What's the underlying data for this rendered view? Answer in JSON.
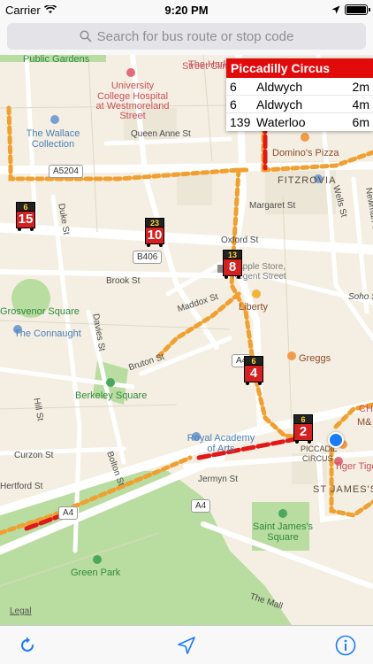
{
  "status": {
    "carrier": "Carrier",
    "time": "9:20 PM"
  },
  "search": {
    "placeholder": "Search for bus route or stop code"
  },
  "map": {
    "labels": {
      "public_gardens": "Public Gardens",
      "harley_street": "The Harley",
      "street_clinic": "Street Clini",
      "uch1": "University",
      "uch2": "College Hospital",
      "uch3": "at Westmoreland",
      "uch4": "Street",
      "queen_anne": "Queen Anne St",
      "wallace1": "The Wallace",
      "wallace2": "Collection",
      "dominos": "Domino's Pizza",
      "fitzrovia": "FITZROVIA",
      "margaret": "Margaret St",
      "wells": "Wells St",
      "newman": "Newman St",
      "duke": "Duke St",
      "oxford": "Oxford St",
      "apple1": "Apple Store,",
      "apple2": "Regent Street",
      "brook": "Brook St",
      "maddox": "Maddox St",
      "liberty": "Liberty",
      "soho": "Soho S",
      "grosvenor": "Grosvenor Square",
      "connaught": "The Connaught",
      "davies": "Davies St",
      "bruton": "Bruton St",
      "greggs": "Greggs",
      "berkeley": "Berkeley Square",
      "hill": "Hill St",
      "royal1": "Royal Academy",
      "royal2": "of Arts",
      "piccadilly1": "PICCADIL",
      "piccadilly2": "CIRCUS",
      "tiger": "Tiger Tige",
      "stjames": "ST JAMES'S",
      "curzon": "Curzon St",
      "bolton": "Bolton St",
      "jermyn": "Jermyn St",
      "hertford": "Hertford St",
      "stjsq1": "Saint James's",
      "stjsq2": "Square",
      "greenpark": "Green Park",
      "themall": "The Mall",
      "ch": "CH",
      "ms": "M&"
    },
    "road_badges": {
      "a5204": "A5204",
      "b406": "B406",
      "a4_main": "A4",
      "a4_b": "A4",
      "a4_small": "A4"
    },
    "legal": "Legal"
  },
  "buses": [
    {
      "top": "6",
      "route": "15"
    },
    {
      "top": "23",
      "route": "10"
    },
    {
      "top": "13",
      "route": "8"
    },
    {
      "top": "6",
      "route": "4"
    },
    {
      "top": "6",
      "route": "2"
    }
  ],
  "popup": {
    "title": "Piccadilly Circus",
    "rows": [
      {
        "route": "6",
        "destination": "Aldwych",
        "time": "2m"
      },
      {
        "route": "6",
        "destination": "Aldwych",
        "time": "4m"
      },
      {
        "route": "139",
        "destination": "Waterloo",
        "time": "6m"
      }
    ]
  },
  "toolbar": {
    "refresh_icon": "refresh-icon",
    "locate_icon": "location-arrow-icon",
    "info_icon": "info-icon"
  },
  "colors": {
    "accent": "#1a7cf5",
    "bus_red": "#d42020",
    "popup_red": "#e10b0b",
    "route_orange": "#f0a030"
  }
}
